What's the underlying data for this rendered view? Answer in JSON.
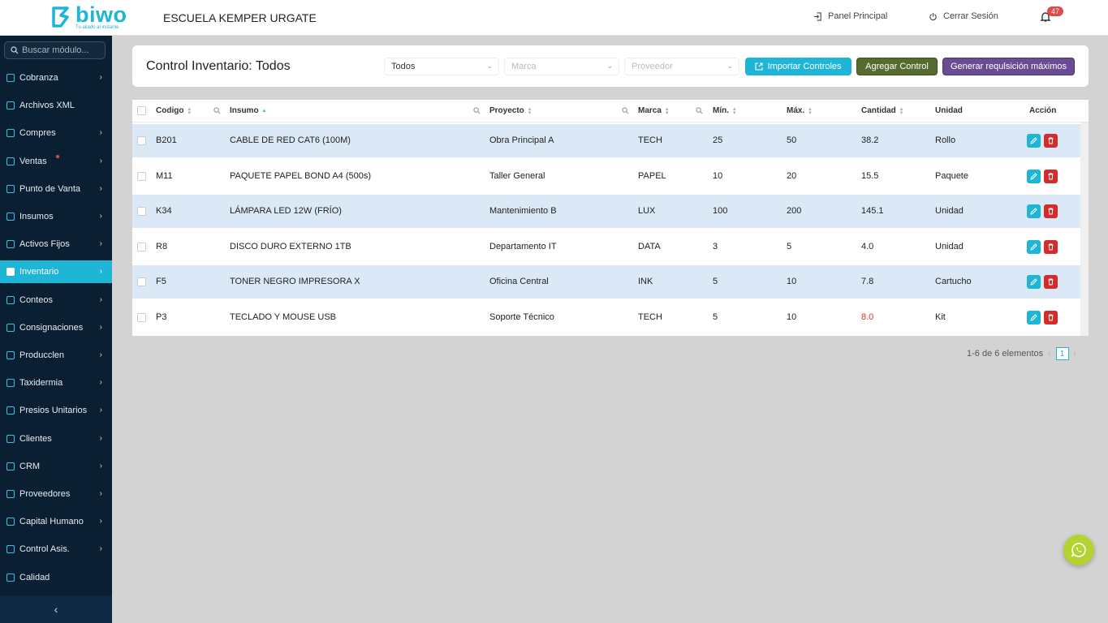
{
  "brand": {
    "name": "biwo",
    "tagline": "Tu aliado al instante",
    "accent": "#1fb5d6"
  },
  "school": "ESCUELA KEMPER URGATE",
  "topbar": {
    "panel_label": "Panel Principal",
    "logout_label": "Cerrar Sesión",
    "notifications": "47"
  },
  "sidebar": {
    "search_placeholder": "Buscar módulo...",
    "items": [
      {
        "label": "Cobranza",
        "chevron": true
      },
      {
        "label": "Archivos XML",
        "chevron": false
      },
      {
        "label": "Compres",
        "chevron": true
      },
      {
        "label": "Ventas",
        "chevron": true,
        "dot": true
      },
      {
        "label": "Punto de Vanta",
        "chevron": true
      },
      {
        "label": "Insumos",
        "chevron": true
      },
      {
        "label": "Activos Fijos",
        "chevron": true
      },
      {
        "label": "Inventario",
        "chevron": true,
        "active": true
      },
      {
        "label": "Conteos",
        "chevron": true
      },
      {
        "label": "Consignaciones",
        "chevron": true
      },
      {
        "label": "Producclen",
        "chevron": true
      },
      {
        "label": "Taxidermia",
        "chevron": true
      },
      {
        "label": "Presios Unitarios",
        "chevron": true
      },
      {
        "label": "Clientes",
        "chevron": true
      },
      {
        "label": "CRM",
        "chevron": true
      },
      {
        "label": "Proveedores",
        "chevron": true
      },
      {
        "label": "Capital Humano",
        "chevron": true
      },
      {
        "label": "Control Asis.",
        "chevron": true
      },
      {
        "label": "Calidad",
        "chevron": false
      }
    ],
    "collapse_glyph": "‹"
  },
  "header": {
    "title": "Control Inventario: Todos",
    "filter_status": "Todos",
    "filter_brand_placeholder": "Marca",
    "filter_provider_placeholder": "Proveedor",
    "import_label": "Importar Controles",
    "add_label": "Agregar Control",
    "generate_label": "Generar requlsición máximos"
  },
  "table": {
    "columns": [
      "Codigo",
      "Insumo",
      "Proyecto",
      "Marca",
      "Mín.",
      "Máx.",
      "Cantidad",
      "Unidad",
      "Acción"
    ],
    "rows": [
      {
        "codigo": "B201",
        "insumo": "CABLE DE RED CAT6 (100M)",
        "proyecto": "Obra Principal A",
        "marca": "TECH",
        "min": "25",
        "max": "50",
        "cantidad": "38.2",
        "unidad": "Rollo"
      },
      {
        "codigo": "M11",
        "insumo": "PAQUETE PAPEL BOND A4 (500s)",
        "proyecto": "Taller General",
        "marca": "PAPEL",
        "min": "10",
        "max": "20",
        "cantidad": "15.5",
        "unidad": "Paquete"
      },
      {
        "codigo": "K34",
        "insumo": "LÁMPARA LED 12W (FRÍO)",
        "proyecto": "Mantenimiento B",
        "marca": "LUX",
        "min": "100",
        "max": "200",
        "cantidad": "145.1",
        "unidad": "Unidad"
      },
      {
        "codigo": "R8",
        "insumo": "DISCO DURO EXTERNO 1TB",
        "proyecto": "Departamento IT",
        "marca": "DATA",
        "min": "3",
        "max": "5",
        "cantidad": "4.0",
        "unidad": "Unidad"
      },
      {
        "codigo": "F5",
        "insumo": "TONER NEGRO IMPRESORA X",
        "proyecto": "Oficina Central",
        "marca": "INK",
        "min": "5",
        "max": "10",
        "cantidad": "7.8",
        "unidad": "Cartucho"
      },
      {
        "codigo": "P3",
        "insumo": "TECLADO Y MOUSE USB",
        "proyecto": "Soporte Técnico",
        "marca": "TECH",
        "min": "5",
        "max": "10",
        "cantidad": "8.0",
        "unidad": "Kit",
        "cantidad_alert": true
      }
    ]
  },
  "pagination": {
    "summary": "1-6 de 6 elementos",
    "current_page": "1"
  }
}
